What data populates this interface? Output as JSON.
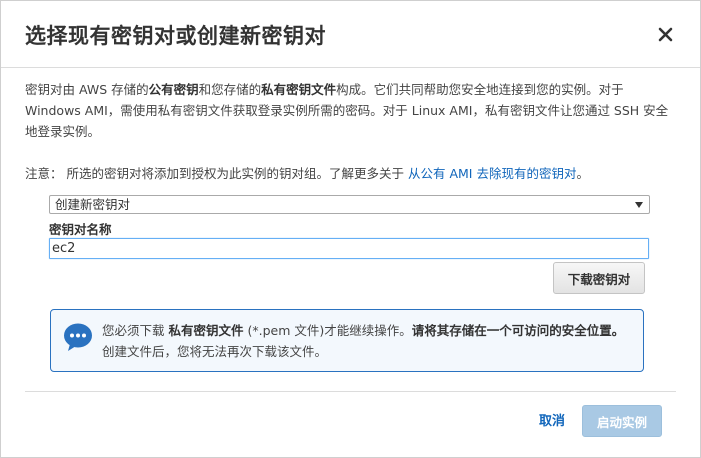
{
  "dialog": {
    "title": "选择现有密钥对或创建新密钥对",
    "close_icon": "close-icon"
  },
  "intro": {
    "p1_a": "密钥对由 AWS 存储的",
    "p1_b": "公有密钥",
    "p1_c": "和您存储的",
    "p1_d": "私有密钥文件",
    "p1_e": "构成。它们共同帮助您安全地连接到您的实例。对于 Windows AMI，需使用私有密钥文件获取登录实例所需的密码。对于 Linux AMI，私有密钥文件让您通过 SSH 安全地登录实例。"
  },
  "note": {
    "prefix": "注意：  所选的密钥对将添加到授权为此实例的钥对组。了解更多关于",
    "link": "从公有 AMI 去除现有的密钥对",
    "suffix": "。"
  },
  "keypair_select": {
    "selected": "创建新密钥对"
  },
  "keypair_name": {
    "label": "密钥对名称",
    "value": "ec2"
  },
  "download_button": "下载密钥对",
  "info": {
    "icon": "chat-bubble-icon",
    "t1": "您必须下载 ",
    "t2": "私有密钥文件",
    "t3": " (*.pem 文件)才能继续操作。",
    "t4": "请将其存储在一个可访问的安全位置。",
    "t5": " 创建文件后，您将无法再次下载该文件。"
  },
  "footer": {
    "cancel": "取消",
    "launch": "启动实例"
  },
  "colors": {
    "link": "#1166bb",
    "info_border": "#2a72c0",
    "launch_disabled": "#a9c9e4"
  }
}
